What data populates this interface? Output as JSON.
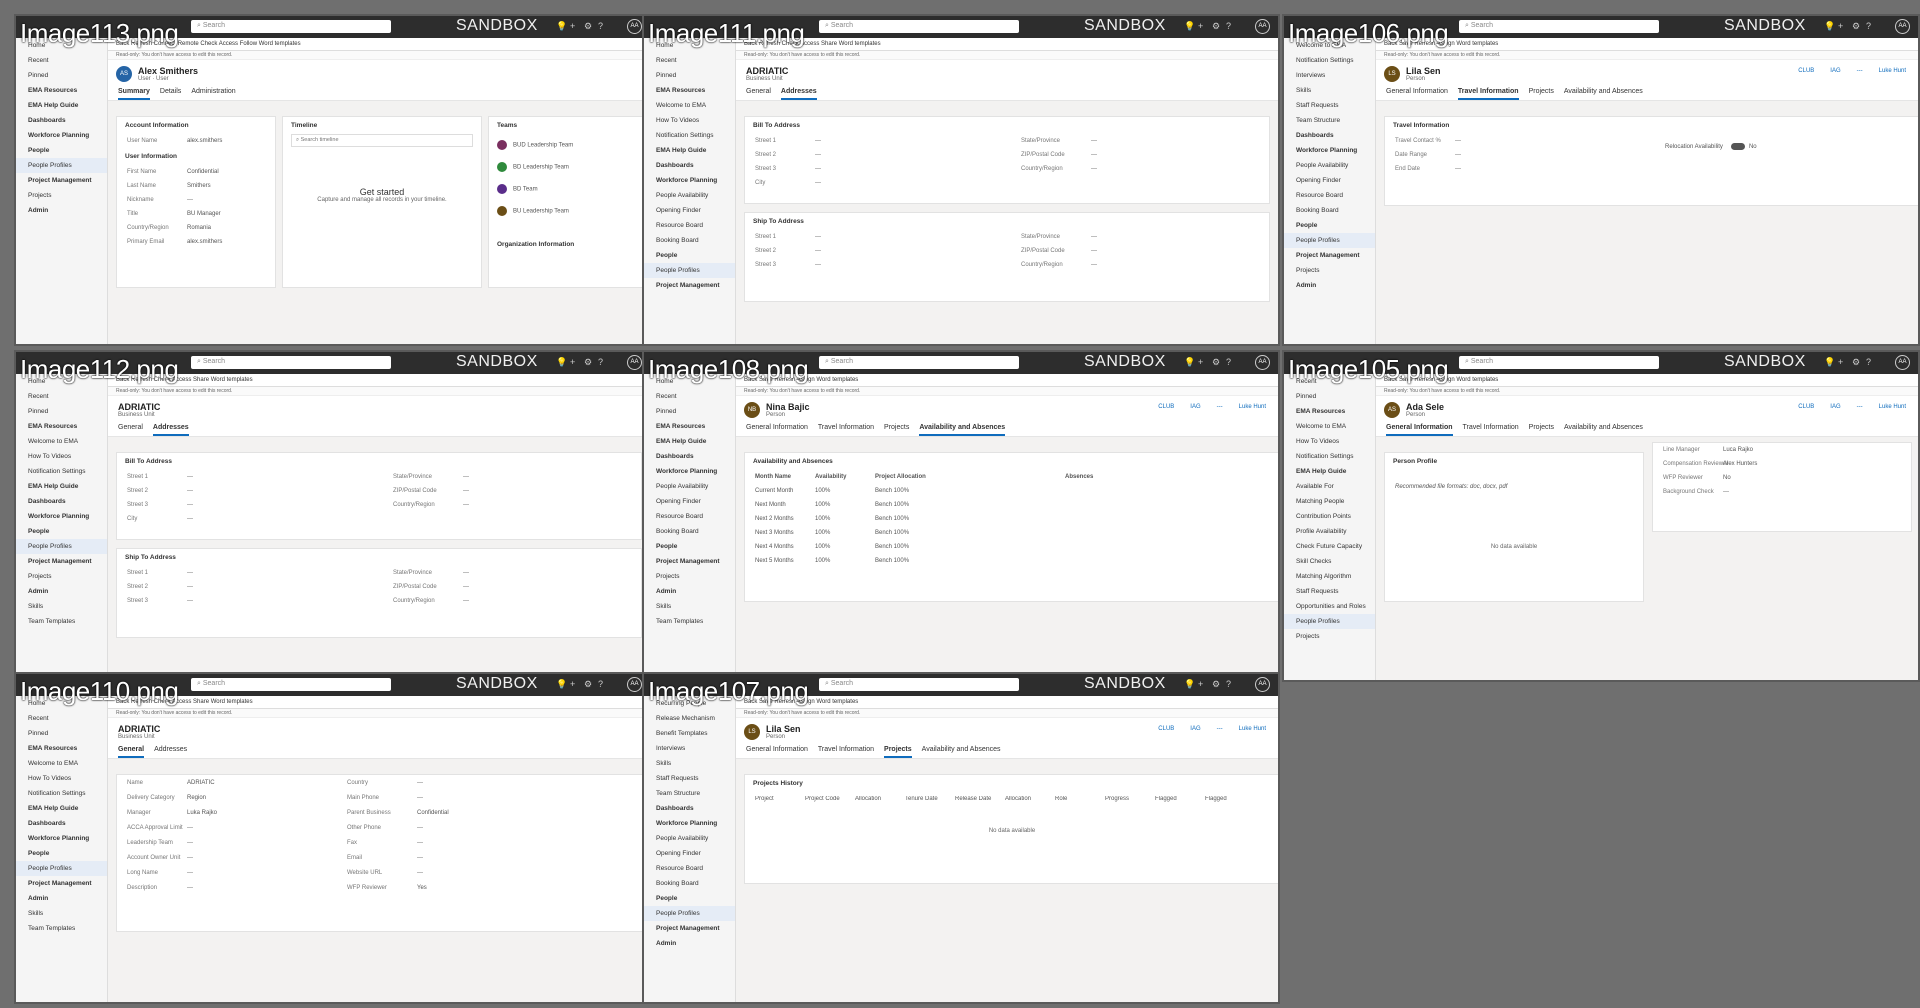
{
  "common": {
    "search_placeholder": "Search",
    "env_label": "SANDBOX",
    "avatar_initials": "AA",
    "notice": "Read-only: You don't have access to edit this record."
  },
  "thumbs": [
    {
      "caption": "Image113.png",
      "nav": [
        "Home",
        "Recent",
        "Pinned",
        "EMA Resources",
        "EMA Help Guide",
        "Dashboards",
        "Workforce Planning",
        "People",
        "People Profiles",
        "Project Management",
        "Projects",
        "Admin"
      ],
      "cmd": "Back  Refresh  Connect  Remote  Check Access  Follow  Word templates",
      "title": "Alex Smithers",
      "subtitle": "User · User",
      "tabs": [
        "Summary",
        "Details",
        "Administration"
      ],
      "section1": "Account Information",
      "section2": "User Information",
      "rows": [
        "User Name",
        "First Name",
        "Last Name",
        "Nickname",
        "Title",
        "Country/Region",
        "Primary Email"
      ],
      "values": [
        "alex.smithers",
        "Confidential",
        "Smithers",
        "---",
        "BU Manager",
        "Romania",
        "alex.smithers"
      ],
      "timeline": "Timeline",
      "timeline_search": "Search timeline",
      "get_started": "Get started",
      "get_started_sub": "Capture and manage all records in your timeline.",
      "teams": "Teams",
      "team_items": [
        "BUD Leadership Team",
        "BD Leadership Team",
        "BD Team",
        "BU Leadership Team"
      ],
      "org": "Organization Information"
    },
    {
      "caption": "Image111.png",
      "nav": [
        "Home",
        "Recent",
        "Pinned",
        "EMA Resources",
        "Welcome to EMA",
        "How To Videos",
        "Notification Settings",
        "EMA Help Guide",
        "Dashboards",
        "Workforce Planning",
        "People Availability",
        "Opening Finder",
        "Resource Board",
        "Booking Board",
        "People",
        "People Profiles",
        "Project Management"
      ],
      "cmd": "Back  Refresh  Check Access  Share  Word templates",
      "title": "ADRIATIC",
      "subtitle": "Business Unit",
      "tabs": [
        "General",
        "Addresses"
      ],
      "section1": "Bill To Address",
      "section2": "Ship To Address",
      "rows": [
        "Street 1",
        "Street 2",
        "Street 3",
        "City"
      ],
      "rows_right": [
        "State/Province",
        "ZIP/Postal Code",
        "Country/Region"
      ]
    },
    {
      "caption": "Image106.png",
      "nav": [
        "Welcome to EMA",
        "Notification Settings",
        "Interviews",
        "Skills",
        "Staff Requests",
        "Team Structure",
        "Dashboards",
        "Workforce Planning",
        "People Availability",
        "Opening Finder",
        "Resource Board",
        "Booking Board",
        "People",
        "People Profiles",
        "Project Management",
        "Projects",
        "Admin"
      ],
      "cmd": "Back  Save  Refresh  Assign  Word templates",
      "title": "Lila Sen",
      "subtitle": "Person",
      "tabs": [
        "General Information",
        "Travel Information",
        "Projects",
        "Availability and Absences"
      ],
      "section1": "Travel Information",
      "rows": [
        "Travel Contact %",
        "Date Range",
        "End Date"
      ],
      "switch_label": "Relocation Availability",
      "switch_val": "No",
      "kpis": [
        "CLUB",
        "IAG",
        "---",
        "Luke Hunt"
      ]
    },
    {
      "caption": "Image112.png",
      "nav": [
        "Home",
        "Recent",
        "Pinned",
        "EMA Resources",
        "Welcome to EMA",
        "How To Videos",
        "Notification Settings",
        "EMA Help Guide",
        "Dashboards",
        "Workforce Planning",
        "People",
        "People Profiles",
        "Project Management",
        "Projects",
        "Admin",
        "Skills",
        "Team Templates"
      ],
      "cmd": "Back  Refresh  Check Access  Share  Word templates",
      "title": "ADRIATIC",
      "subtitle": "Business Unit",
      "tabs": [
        "General",
        "Addresses"
      ],
      "section1": "Bill To Address",
      "section2": "Ship To Address",
      "rows": [
        "Street 1",
        "Street 2",
        "Street 3",
        "City"
      ],
      "rows_right": [
        "State/Province",
        "ZIP/Postal Code",
        "Country/Region"
      ]
    },
    {
      "caption": "Image108.png",
      "nav": [
        "Home",
        "Recent",
        "Pinned",
        "EMA Resources",
        "EMA Help Guide",
        "Dashboards",
        "Workforce Planning",
        "People Availability",
        "Opening Finder",
        "Resource Board",
        "Booking Board",
        "People",
        "Project Management",
        "Projects",
        "Admin",
        "Skills",
        "Team Templates"
      ],
      "cmd": "Back  Save  Refresh  Assign  Word templates",
      "title": "Nina Bajic",
      "subtitle": "Person",
      "tabs": [
        "General Information",
        "Travel Information",
        "Projects",
        "Availability and Absences"
      ],
      "section1": "Availability and Absences",
      "table_head": [
        "Month Name",
        "Availability",
        "Project Allocation",
        "Absences"
      ],
      "table_rows": [
        [
          "Current Month",
          "100%",
          "Bench 100%"
        ],
        [
          "Next Month",
          "100%",
          "Bench 100%"
        ],
        [
          "Next 2 Months",
          "100%",
          "Bench 100%"
        ],
        [
          "Next 3 Months",
          "100%",
          "Bench 100%"
        ],
        [
          "Next 4 Months",
          "100%",
          "Bench 100%"
        ],
        [
          "Next 5 Months",
          "100%",
          "Bench 100%"
        ]
      ],
      "kpis": [
        "CLUB",
        "IAG",
        "---",
        "Luke Hunt"
      ]
    },
    {
      "caption": "Image105.png",
      "nav": [
        "Recent",
        "Pinned",
        "EMA Resources",
        "Welcome to EMA",
        "How To Videos",
        "Notification Settings",
        "EMA Help Guide",
        "Available For",
        "Matching People",
        "Contribution Points",
        "Profile Availability",
        "Check Future Capacity",
        "Skill Checks",
        "Matching Algorithm",
        "Staff Requests",
        "Opportunities and Roles",
        "People Profiles",
        "Projects"
      ],
      "cmd": "Back  Save  Refresh  Assign  Word templates",
      "title": "Ada Sele",
      "subtitle": "Person",
      "tabs": [
        "General Information",
        "Travel Information",
        "Projects",
        "Availability and Absences"
      ],
      "section1": "Person Profile",
      "recommend": "Recommended file formats: doc, docx, pdf",
      "no_data": "No data available",
      "rows_right": [
        "Line Manager",
        "Compensation Reviewer",
        "WFP Reviewer",
        "Background Check"
      ],
      "values_right": [
        "Luca Rajko",
        "Alex Hunters",
        "No",
        "---"
      ],
      "kpis": [
        "CLUB",
        "IAG",
        "---",
        "Luke Hunt"
      ]
    },
    {
      "caption": "Image110.png",
      "nav": [
        "Home",
        "Recent",
        "Pinned",
        "EMA Resources",
        "Welcome to EMA",
        "How To Videos",
        "Notification Settings",
        "EMA Help Guide",
        "Dashboards",
        "Workforce Planning",
        "People",
        "People Profiles",
        "Project Management",
        "Admin",
        "Skills",
        "Team Templates"
      ],
      "cmd": "Back  Refresh  Check Access  Share  Word templates",
      "title": "ADRIATIC",
      "subtitle": "Business Unit",
      "tabs": [
        "General",
        "Addresses"
      ],
      "rows": [
        "Name",
        "Delivery Category",
        "Manager",
        "ACCA Approval Limit",
        "Leadership Team",
        "Account Owner Unit",
        "Long Name",
        "Description"
      ],
      "values": [
        "ADRIATIC",
        "Region",
        "Luka Rajko",
        "---",
        "---",
        "---",
        "---",
        "---"
      ],
      "rows_right": [
        "Country",
        "Main Phone",
        "Parent Business",
        "Other Phone",
        "Fax",
        "Email",
        "Website URL",
        "WFP Reviewer"
      ],
      "values_right": [
        "---",
        "---",
        "Confidential",
        "---",
        "---",
        "---",
        "---",
        "Yes"
      ]
    },
    {
      "caption": "Image107.png",
      "nav": [
        "Recurring People",
        "Release Mechanism",
        "Benefit Templates",
        "Interviews",
        "Skills",
        "Staff Requests",
        "Team Structure",
        "Dashboards",
        "Workforce Planning",
        "People Availability",
        "Opening Finder",
        "Resource Board",
        "Booking Board",
        "People",
        "People Profiles",
        "Project Management",
        "Admin"
      ],
      "cmd": "Back  Save  Refresh  Assign  Word templates",
      "title": "Lila Sen",
      "subtitle": "Person",
      "tabs": [
        "General Information",
        "Travel Information",
        "Projects",
        "Availability and Absences"
      ],
      "section1": "Projects History",
      "table_head": [
        "Project",
        "Project Code",
        "Allocation",
        "Tenure Date",
        "Release Date",
        "Allocation",
        "Role",
        "Progress",
        "Flagged",
        "Flagged"
      ],
      "no_data": "No data available",
      "kpis": [
        "CLUB",
        "IAG",
        "---",
        "Luke Hunt"
      ]
    }
  ]
}
